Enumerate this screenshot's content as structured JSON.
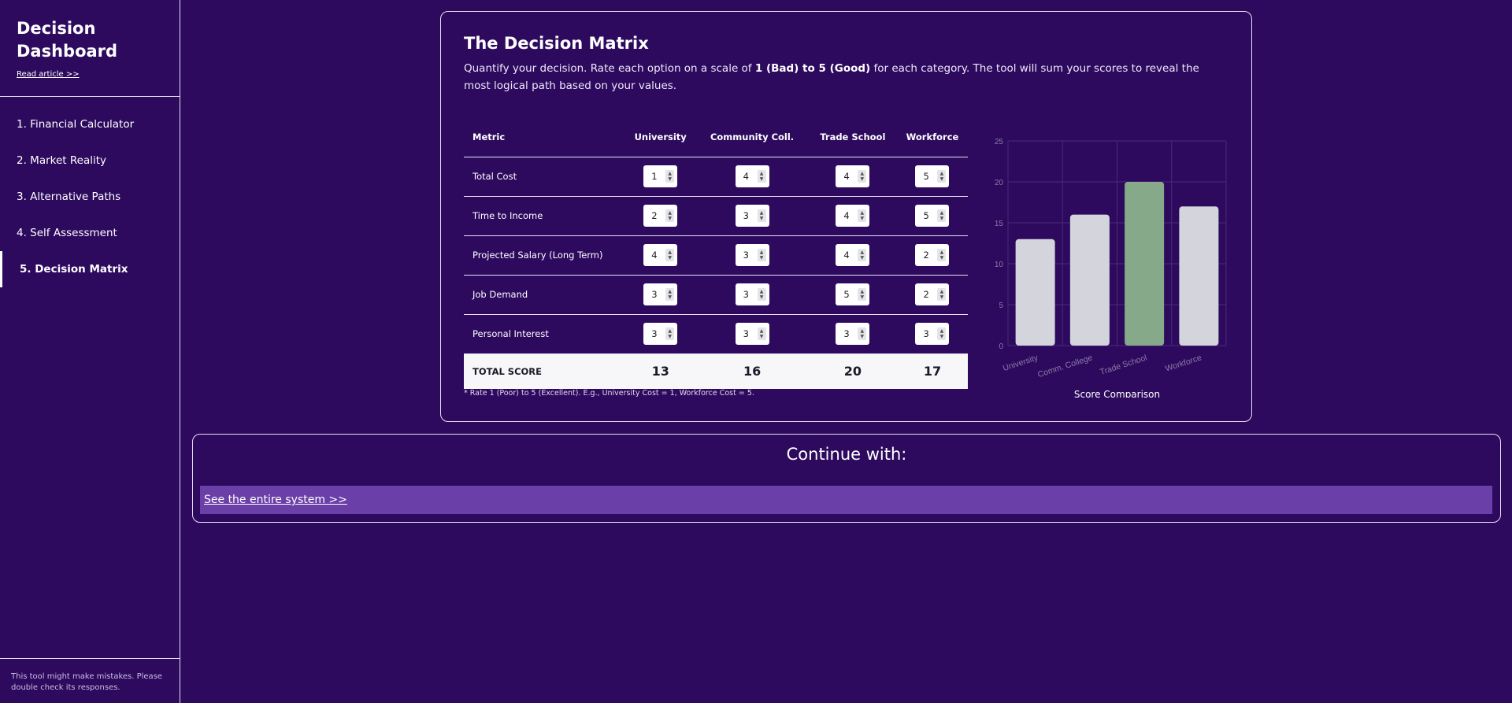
{
  "sidebar": {
    "title": "Decision Dashboard",
    "read_article": "Read article >>",
    "items": [
      {
        "label": "1. Financial Calculator"
      },
      {
        "label": "2. Market Reality"
      },
      {
        "label": "3. Alternative Paths"
      },
      {
        "label": "4. Self Assessment"
      },
      {
        "label": "5. Decision Matrix",
        "active": true
      }
    ],
    "disclaimer": "This tool might make mistakes. Please double check its responses."
  },
  "matrix": {
    "title": "The Decision Matrix",
    "desc_pre": "Quantify your decision. Rate each option on a scale of ",
    "desc_bold": "1 (Bad) to 5 (Good)",
    "desc_post": " for each category. The tool will sum your scores to reveal the most logical path based on your values.",
    "headers": [
      "Metric",
      "University",
      "Community Coll.",
      "Trade School",
      "Workforce"
    ],
    "rows": [
      {
        "metric": "Total Cost",
        "values": [
          "1",
          "4",
          "4",
          "5"
        ]
      },
      {
        "metric": "Time to Income",
        "values": [
          "2",
          "3",
          "4",
          "5"
        ]
      },
      {
        "metric": "Projected Salary (Long Term)",
        "values": [
          "4",
          "3",
          "4",
          "2"
        ]
      },
      {
        "metric": "Job Demand",
        "values": [
          "3",
          "3",
          "5",
          "2"
        ]
      },
      {
        "metric": "Personal Interest",
        "values": [
          "3",
          "3",
          "3",
          "3"
        ]
      }
    ],
    "total_label": "TOTAL SCORE",
    "totals": [
      "13",
      "16",
      "20",
      "17"
    ],
    "footnote": "* Rate 1 (Poor) to 5 (Excellent). E.g., University Cost = 1, Workforce Cost = 5."
  },
  "chart_data": {
    "type": "bar",
    "categories": [
      "University",
      "Comm. College",
      "Trade School",
      "Workforce"
    ],
    "values": [
      13,
      16,
      20,
      17
    ],
    "title": "Score Comparison",
    "ylim": [
      0,
      25
    ],
    "yticks": [
      0,
      5,
      10,
      15,
      20,
      25
    ],
    "grid": true,
    "colors": {
      "default": "#d3d4dc",
      "highlight": "#86a98a"
    },
    "highlight_index": 2
  },
  "continue": {
    "title": "Continue with:",
    "link": "See the entire system >>"
  }
}
